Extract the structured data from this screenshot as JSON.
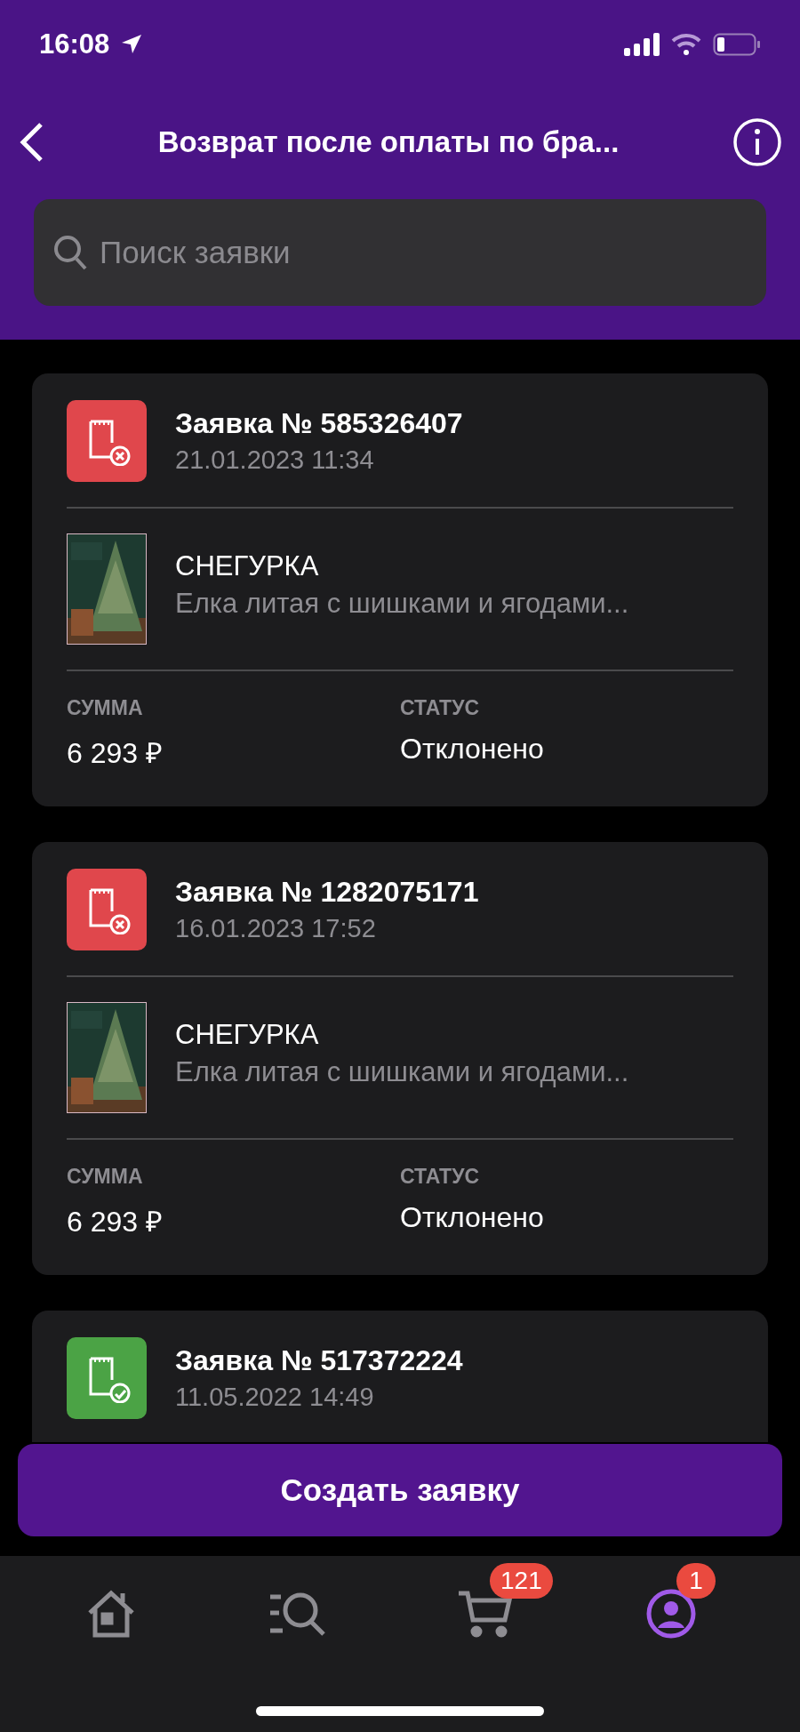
{
  "status_bar": {
    "time": "16:08"
  },
  "header": {
    "title": "Возврат после оплаты по бра..."
  },
  "search": {
    "placeholder": "Поиск заявки"
  },
  "requests": [
    {
      "number": "Заявка № 585326407",
      "date": "21.01.2023 11:34",
      "kind": "rejected",
      "product": {
        "brand": "СНЕГУРКА",
        "description": "Елка литая с шишками и ягодами...",
        "kind": "picture"
      },
      "sum_label": "СУММА",
      "sum": "6 293 ₽",
      "status_label": "СТАТУС",
      "status": "Отклонено"
    },
    {
      "number": "Заявка № 1282075171",
      "date": "16.01.2023 17:52",
      "kind": "rejected",
      "product": {
        "brand": "СНЕГУРКА",
        "description": "Елка литая с шишками и ягодами...",
        "kind": "picture"
      },
      "sum_label": "СУММА",
      "sum": "6 293 ₽",
      "status_label": "СТАТУС",
      "status": "Отклонено"
    },
    {
      "number": "Заявка № 517372224",
      "date": "11.05.2022 14:49",
      "kind": "approved"
    }
  ],
  "create_button": "Создать заявку",
  "tabs": [
    {
      "kind": "home",
      "selected": false
    },
    {
      "kind": "catalog",
      "selected": false
    },
    {
      "kind": "cart",
      "selected": false,
      "badge": "121"
    },
    {
      "kind": "profile",
      "selected": true,
      "badge": "1"
    }
  ]
}
